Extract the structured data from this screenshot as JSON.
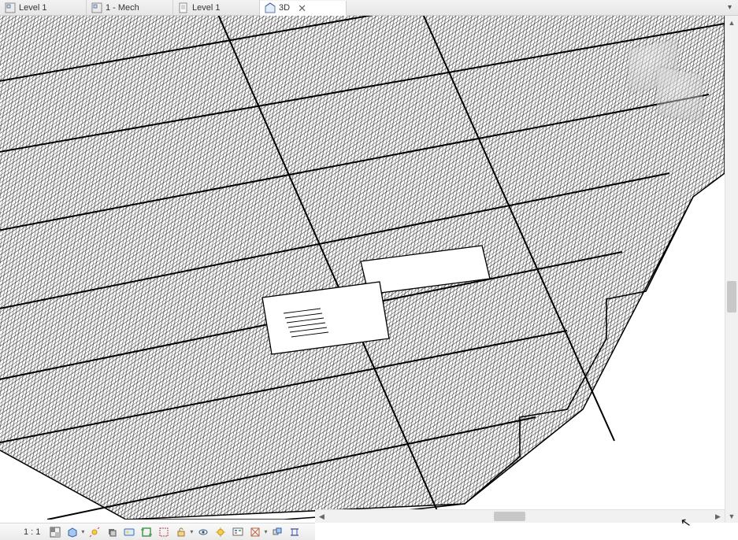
{
  "tabs": [
    {
      "label": "Level 1",
      "icon": "floor-plan-icon",
      "active": false
    },
    {
      "label": "1 - Mech",
      "icon": "floor-plan-icon",
      "active": false
    },
    {
      "label": "Level 1",
      "icon": "sheet-icon",
      "active": false
    },
    {
      "label": "3D",
      "icon": "house-3d-icon",
      "active": true
    }
  ],
  "close_glyph": "✕",
  "tab_menu_glyph": "▾",
  "view_controls": {
    "scale": "1 : 1",
    "buttons": [
      {
        "name": "detail-level",
        "title": "Detail Level"
      },
      {
        "name": "visual-style",
        "title": "Visual Style"
      },
      {
        "name": "sun-path",
        "title": "Sun Path Off"
      },
      {
        "name": "shadows",
        "title": "Shadows Off"
      },
      {
        "name": "rendering-dialog",
        "title": "Show Rendering Dialog"
      },
      {
        "name": "crop-view",
        "title": "Crop View"
      },
      {
        "name": "show-crop",
        "title": "Show Crop Region"
      },
      {
        "name": "unlocked-3d",
        "title": "Unlocked 3D View"
      },
      {
        "name": "temp-hide",
        "title": "Temporary Hide/Isolate"
      },
      {
        "name": "reveal-hidden",
        "title": "Reveal Hidden Elements"
      },
      {
        "name": "worksharing-display",
        "title": "Worksharing Display"
      },
      {
        "name": "analytical-model",
        "title": "Show Analytical Model"
      },
      {
        "name": "highlight-displacement",
        "title": "Highlight Displacement Sets"
      },
      {
        "name": "reveal-constraints",
        "title": "Reveal Constraints"
      }
    ]
  },
  "scroll": {
    "up_glyph": "▲",
    "down_glyph": "▼",
    "left_glyph": "◀",
    "right_glyph": "▶"
  }
}
